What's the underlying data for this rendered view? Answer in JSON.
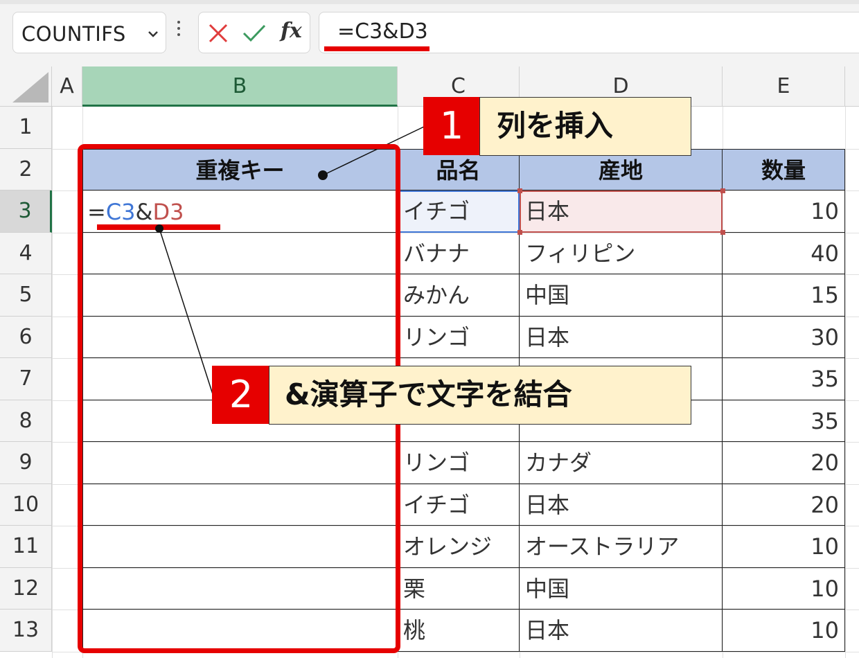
{
  "formula_bar": {
    "name_box": "COUNTIFS",
    "formula": "=C3&D3",
    "cancel_icon": "x-icon",
    "confirm_icon": "check-icon",
    "fx_label": "fx"
  },
  "columns": [
    "A",
    "B",
    "C",
    "D",
    "E"
  ],
  "rows": [
    "1",
    "2",
    "3",
    "4",
    "5",
    "6",
    "7",
    "8",
    "9",
    "10",
    "11",
    "12",
    "13"
  ],
  "table": {
    "headers": [
      "重複キー",
      "品名",
      "産地",
      "数量"
    ],
    "rows": [
      {
        "name": "イチゴ",
        "origin": "日本",
        "qty": "10"
      },
      {
        "name": "バナナ",
        "origin": "フィリピン",
        "qty": "40"
      },
      {
        "name": "みかん",
        "origin": "中国",
        "qty": "15"
      },
      {
        "name": "リンゴ",
        "origin": "日本",
        "qty": "30"
      },
      {
        "name": "",
        "origin": "",
        "qty": "35"
      },
      {
        "name": "",
        "origin": "",
        "qty": "35"
      },
      {
        "name": "リンゴ",
        "origin": "カナダ",
        "qty": "20"
      },
      {
        "name": "イチゴ",
        "origin": "日本",
        "qty": "20"
      },
      {
        "name": "オレンジ",
        "origin": "オーストラリア",
        "qty": "10"
      },
      {
        "name": "栗",
        "origin": "中国",
        "qty": "10"
      },
      {
        "name": "桃",
        "origin": "日本",
        "qty": "10"
      }
    ]
  },
  "b3_formula": {
    "eq": "=",
    "ref1": "C3",
    "amp": "&",
    "ref2": "D3"
  },
  "callouts": [
    {
      "number": "1",
      "text": "列を挿入"
    },
    {
      "number": "2",
      "text": "&演算子で文字を結合"
    }
  ],
  "colors": {
    "accent_red": "#e60000",
    "header_fill": "#b4c6e7",
    "callout_fill": "#fff2cc",
    "selected_col": "#a7d5b8"
  }
}
